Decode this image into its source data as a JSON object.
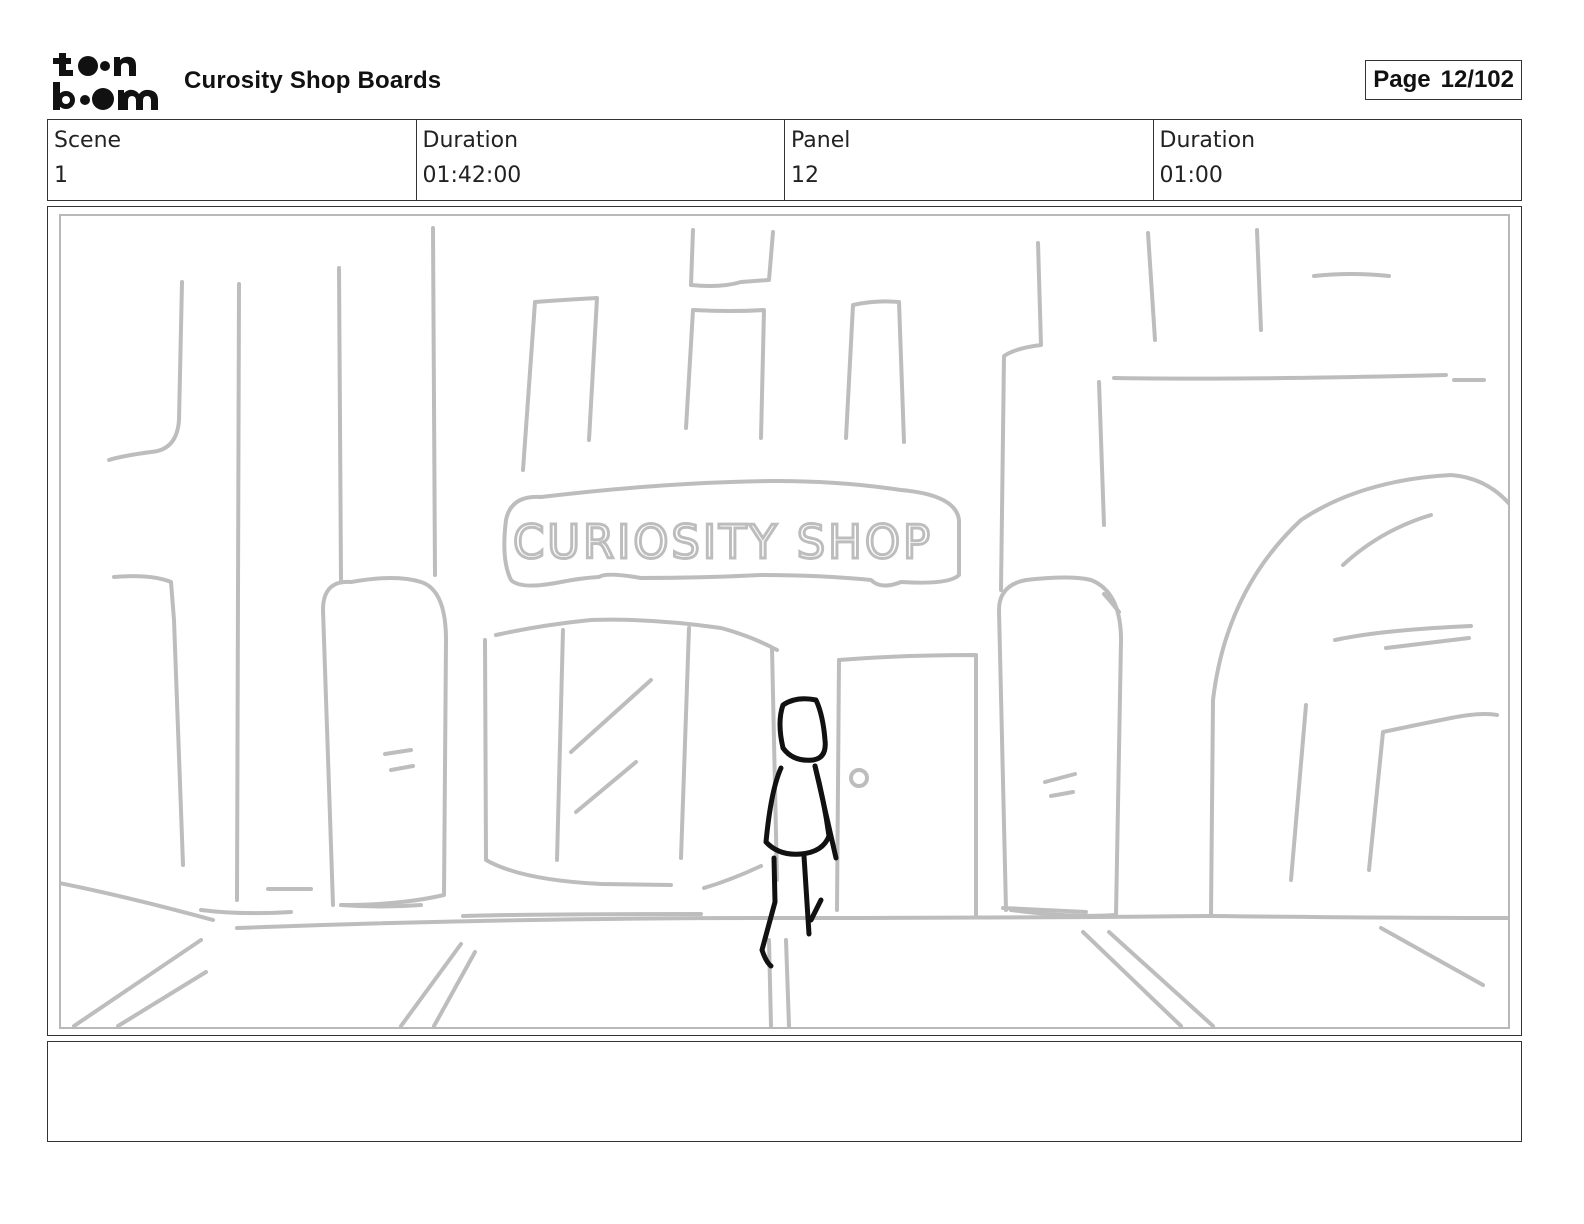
{
  "header": {
    "logo_text": "toon boom",
    "title": "Curosity Shop Boards",
    "page_label": "Page",
    "page_value": "12/102"
  },
  "info": {
    "scene_label": "Scene",
    "scene_value": "1",
    "scene_duration_label": "Duration",
    "scene_duration_value": "01:42:00",
    "panel_label": "Panel",
    "panel_value": "12",
    "panel_duration_label": "Duration",
    "panel_duration_value": "01:00"
  },
  "panel": {
    "sign_text": "CURIOSITY SHOP",
    "sketch_color": "#bdbdbd",
    "character_color": "#111111"
  },
  "notes": {
    "text": ""
  }
}
